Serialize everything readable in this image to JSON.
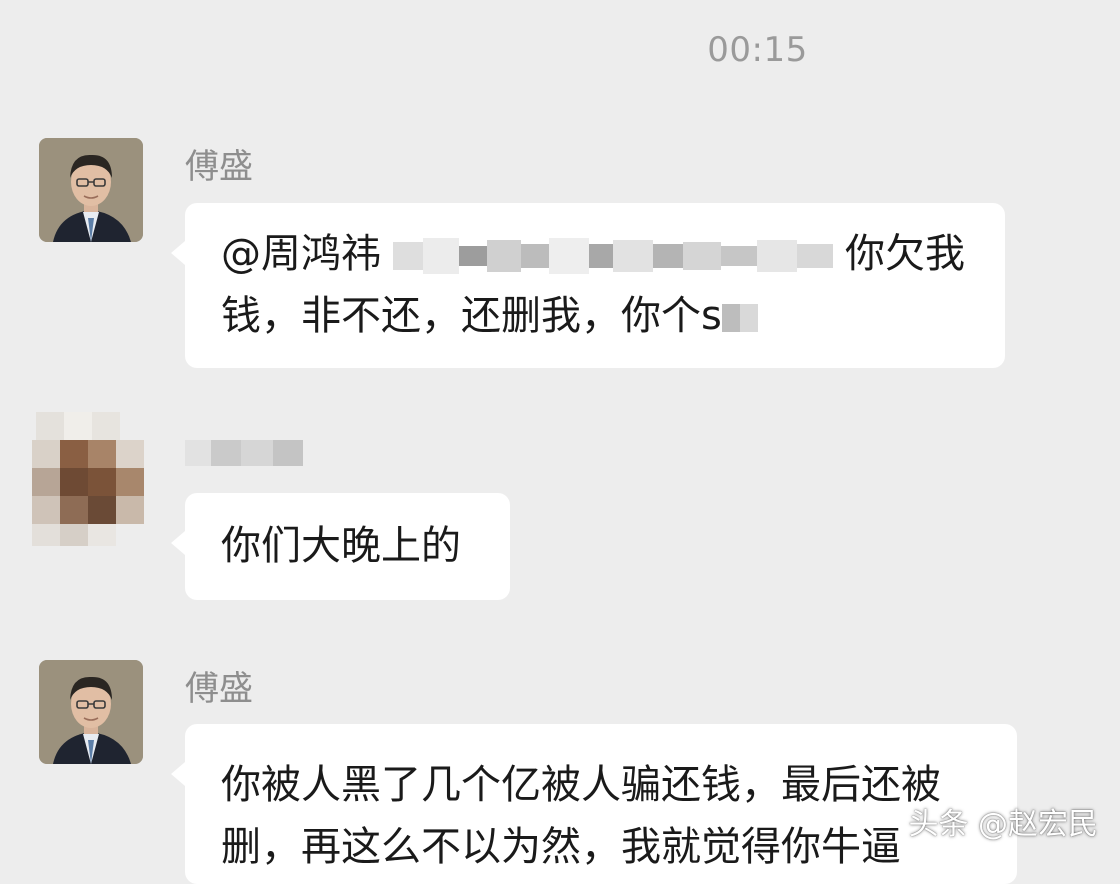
{
  "chat": {
    "timestamp": "00:15",
    "messages": [
      {
        "sender": "傅盛",
        "avatar": "portrait-avatar",
        "lines": [
          "@周鸿祎",
          "你欠我",
          "钱，非不还，还删我，你个s"
        ]
      },
      {
        "sender": "",
        "avatar": "blurred-avatar",
        "lines": [
          "你们大晚上的"
        ]
      },
      {
        "sender": "傅盛",
        "avatar": "portrait-avatar",
        "lines": [
          "你被人黑了几个亿被人骗还钱，最后还被",
          "删，再这么不以为然，我就觉得你牛逼"
        ]
      }
    ]
  },
  "watermark": "头条 @赵宏民",
  "colors": {
    "background": "#ededed",
    "bubble": "#ffffff",
    "timestamp": "#9a9a9a",
    "name": "#8e8e8e"
  }
}
